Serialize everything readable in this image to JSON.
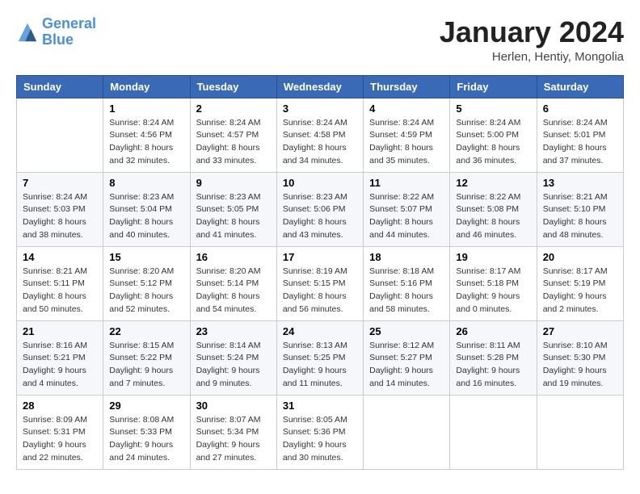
{
  "header": {
    "logo_line1": "General",
    "logo_line2": "Blue",
    "month_title": "January 2024",
    "subtitle": "Herlen, Hentiy, Mongolia"
  },
  "days_of_week": [
    "Sunday",
    "Monday",
    "Tuesday",
    "Wednesday",
    "Thursday",
    "Friday",
    "Saturday"
  ],
  "weeks": [
    [
      {
        "day": "",
        "sunrise": "",
        "sunset": "",
        "daylight": ""
      },
      {
        "day": "1",
        "sunrise": "Sunrise: 8:24 AM",
        "sunset": "Sunset: 4:56 PM",
        "daylight": "Daylight: 8 hours and 32 minutes."
      },
      {
        "day": "2",
        "sunrise": "Sunrise: 8:24 AM",
        "sunset": "Sunset: 4:57 PM",
        "daylight": "Daylight: 8 hours and 33 minutes."
      },
      {
        "day": "3",
        "sunrise": "Sunrise: 8:24 AM",
        "sunset": "Sunset: 4:58 PM",
        "daylight": "Daylight: 8 hours and 34 minutes."
      },
      {
        "day": "4",
        "sunrise": "Sunrise: 8:24 AM",
        "sunset": "Sunset: 4:59 PM",
        "daylight": "Daylight: 8 hours and 35 minutes."
      },
      {
        "day": "5",
        "sunrise": "Sunrise: 8:24 AM",
        "sunset": "Sunset: 5:00 PM",
        "daylight": "Daylight: 8 hours and 36 minutes."
      },
      {
        "day": "6",
        "sunrise": "Sunrise: 8:24 AM",
        "sunset": "Sunset: 5:01 PM",
        "daylight": "Daylight: 8 hours and 37 minutes."
      }
    ],
    [
      {
        "day": "7",
        "sunrise": "Sunrise: 8:24 AM",
        "sunset": "Sunset: 5:03 PM",
        "daylight": "Daylight: 8 hours and 38 minutes."
      },
      {
        "day": "8",
        "sunrise": "Sunrise: 8:23 AM",
        "sunset": "Sunset: 5:04 PM",
        "daylight": "Daylight: 8 hours and 40 minutes."
      },
      {
        "day": "9",
        "sunrise": "Sunrise: 8:23 AM",
        "sunset": "Sunset: 5:05 PM",
        "daylight": "Daylight: 8 hours and 41 minutes."
      },
      {
        "day": "10",
        "sunrise": "Sunrise: 8:23 AM",
        "sunset": "Sunset: 5:06 PM",
        "daylight": "Daylight: 8 hours and 43 minutes."
      },
      {
        "day": "11",
        "sunrise": "Sunrise: 8:22 AM",
        "sunset": "Sunset: 5:07 PM",
        "daylight": "Daylight: 8 hours and 44 minutes."
      },
      {
        "day": "12",
        "sunrise": "Sunrise: 8:22 AM",
        "sunset": "Sunset: 5:08 PM",
        "daylight": "Daylight: 8 hours and 46 minutes."
      },
      {
        "day": "13",
        "sunrise": "Sunrise: 8:21 AM",
        "sunset": "Sunset: 5:10 PM",
        "daylight": "Daylight: 8 hours and 48 minutes."
      }
    ],
    [
      {
        "day": "14",
        "sunrise": "Sunrise: 8:21 AM",
        "sunset": "Sunset: 5:11 PM",
        "daylight": "Daylight: 8 hours and 50 minutes."
      },
      {
        "day": "15",
        "sunrise": "Sunrise: 8:20 AM",
        "sunset": "Sunset: 5:12 PM",
        "daylight": "Daylight: 8 hours and 52 minutes."
      },
      {
        "day": "16",
        "sunrise": "Sunrise: 8:20 AM",
        "sunset": "Sunset: 5:14 PM",
        "daylight": "Daylight: 8 hours and 54 minutes."
      },
      {
        "day": "17",
        "sunrise": "Sunrise: 8:19 AM",
        "sunset": "Sunset: 5:15 PM",
        "daylight": "Daylight: 8 hours and 56 minutes."
      },
      {
        "day": "18",
        "sunrise": "Sunrise: 8:18 AM",
        "sunset": "Sunset: 5:16 PM",
        "daylight": "Daylight: 8 hours and 58 minutes."
      },
      {
        "day": "19",
        "sunrise": "Sunrise: 8:17 AM",
        "sunset": "Sunset: 5:18 PM",
        "daylight": "Daylight: 9 hours and 0 minutes."
      },
      {
        "day": "20",
        "sunrise": "Sunrise: 8:17 AM",
        "sunset": "Sunset: 5:19 PM",
        "daylight": "Daylight: 9 hours and 2 minutes."
      }
    ],
    [
      {
        "day": "21",
        "sunrise": "Sunrise: 8:16 AM",
        "sunset": "Sunset: 5:21 PM",
        "daylight": "Daylight: 9 hours and 4 minutes."
      },
      {
        "day": "22",
        "sunrise": "Sunrise: 8:15 AM",
        "sunset": "Sunset: 5:22 PM",
        "daylight": "Daylight: 9 hours and 7 minutes."
      },
      {
        "day": "23",
        "sunrise": "Sunrise: 8:14 AM",
        "sunset": "Sunset: 5:24 PM",
        "daylight": "Daylight: 9 hours and 9 minutes."
      },
      {
        "day": "24",
        "sunrise": "Sunrise: 8:13 AM",
        "sunset": "Sunset: 5:25 PM",
        "daylight": "Daylight: 9 hours and 11 minutes."
      },
      {
        "day": "25",
        "sunrise": "Sunrise: 8:12 AM",
        "sunset": "Sunset: 5:27 PM",
        "daylight": "Daylight: 9 hours and 14 minutes."
      },
      {
        "day": "26",
        "sunrise": "Sunrise: 8:11 AM",
        "sunset": "Sunset: 5:28 PM",
        "daylight": "Daylight: 9 hours and 16 minutes."
      },
      {
        "day": "27",
        "sunrise": "Sunrise: 8:10 AM",
        "sunset": "Sunset: 5:30 PM",
        "daylight": "Daylight: 9 hours and 19 minutes."
      }
    ],
    [
      {
        "day": "28",
        "sunrise": "Sunrise: 8:09 AM",
        "sunset": "Sunset: 5:31 PM",
        "daylight": "Daylight: 9 hours and 22 minutes."
      },
      {
        "day": "29",
        "sunrise": "Sunrise: 8:08 AM",
        "sunset": "Sunset: 5:33 PM",
        "daylight": "Daylight: 9 hours and 24 minutes."
      },
      {
        "day": "30",
        "sunrise": "Sunrise: 8:07 AM",
        "sunset": "Sunset: 5:34 PM",
        "daylight": "Daylight: 9 hours and 27 minutes."
      },
      {
        "day": "31",
        "sunrise": "Sunrise: 8:05 AM",
        "sunset": "Sunset: 5:36 PM",
        "daylight": "Daylight: 9 hours and 30 minutes."
      },
      {
        "day": "",
        "sunrise": "",
        "sunset": "",
        "daylight": ""
      },
      {
        "day": "",
        "sunrise": "",
        "sunset": "",
        "daylight": ""
      },
      {
        "day": "",
        "sunrise": "",
        "sunset": "",
        "daylight": ""
      }
    ]
  ]
}
